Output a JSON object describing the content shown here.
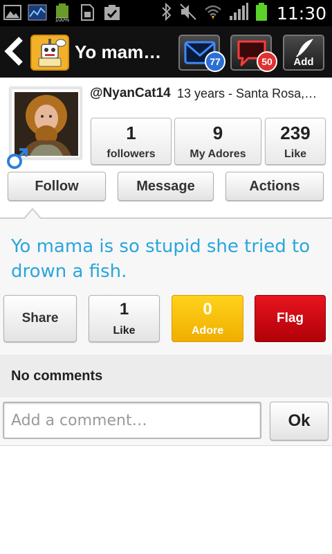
{
  "status_bar": {
    "time": "11:30",
    "battery_small_label": "100%",
    "icons": [
      "gallery-icon",
      "stocks-icon",
      "battery-icon",
      "sd-card-icon",
      "checklist-icon",
      "bluetooth-icon",
      "mute-icon",
      "wifi-icon",
      "signal-icon",
      "battery-icon"
    ]
  },
  "header": {
    "title": "Yo mama…",
    "messages_badge": "77",
    "comments_badge": "50",
    "add_label": "Add"
  },
  "profile": {
    "username": "@NyanCat14",
    "meta": "13 years - Santa Rosa,…",
    "stats": [
      {
        "value": "1",
        "label": "followers"
      },
      {
        "value": "9",
        "label": "My Adores"
      },
      {
        "value": "239",
        "label": "Like"
      }
    ],
    "buttons": {
      "follow": "Follow",
      "message": "Message",
      "actions": "Actions"
    }
  },
  "post": {
    "text": "Yo mama is so stupid she tried to drown a fish.",
    "share_label": "Share",
    "like_count": "1",
    "like_label": "Like",
    "adore_count": "0",
    "adore_label": "Adore",
    "flag_label": "Flag"
  },
  "comments": {
    "empty_text": "No comments",
    "input_placeholder": "Add a comment…",
    "ok_label": "Ok"
  },
  "colors": {
    "post_text": "#29a6db",
    "adore": "#f5b800",
    "flag": "#c8000a",
    "messages_badge": "#2b6fd6",
    "comments_badge": "#e03030"
  }
}
